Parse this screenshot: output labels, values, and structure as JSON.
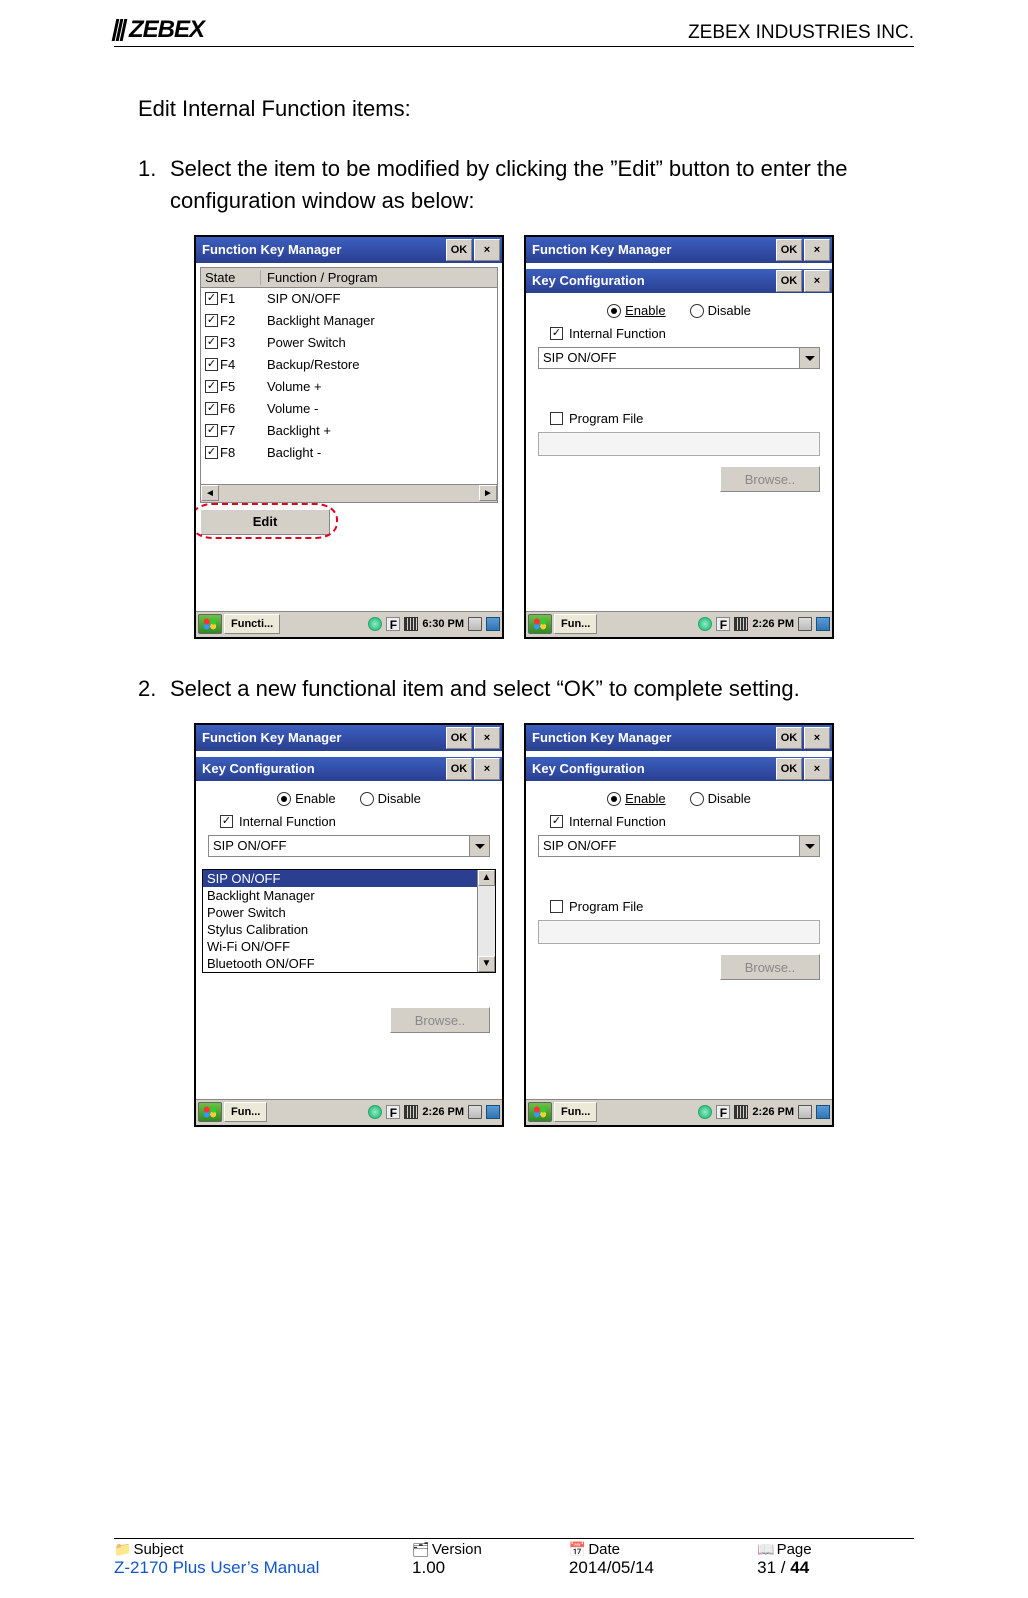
{
  "header": {
    "logo_text": "ZEBEX",
    "company": "ZEBEX INDUSTRIES INC."
  },
  "text": {
    "intro": "Edit Internal Function items:",
    "step1_num": "1.",
    "step1": "Select the item to be modified by clicking the ”Edit” button to enter the configuration window as below:",
    "step2_num": "2.",
    "step2": "Select a new functional item and select “OK” to complete setting."
  },
  "winCE": {
    "mainTitle": "Function Key Manager",
    "ok": "OK",
    "close": "×",
    "edit": "Edit",
    "headers": {
      "state": "State",
      "func": "Function / Program"
    },
    "rows": [
      {
        "key": "F1",
        "fn": "SIP ON/OFF"
      },
      {
        "key": "F2",
        "fn": "Backlight Manager"
      },
      {
        "key": "F3",
        "fn": "Power Switch"
      },
      {
        "key": "F4",
        "fn": "Backup/Restore"
      },
      {
        "key": "F5",
        "fn": "Volume +"
      },
      {
        "key": "F6",
        "fn": "Volume -"
      },
      {
        "key": "F7",
        "fn": "Backlight +"
      },
      {
        "key": "F8",
        "fn": "Baclight -"
      }
    ],
    "task_long": "Functi...",
    "task_short": "Fun...",
    "time_a": "6:30 PM",
    "time_b": "2:26 PM"
  },
  "keyConfig": {
    "title": "Key Configuration",
    "enable": "Enable",
    "disable": "Disable",
    "internalFn": "Internal Function",
    "programFile": "Program File",
    "browse": "Browse..",
    "selected": "SIP ON/OFF",
    "options": [
      "SIP ON/OFF",
      "Backlight Manager",
      "Power Switch",
      "Stylus Calibration",
      "Wi-Fi ON/OFF",
      "Bluetooth ON/OFF"
    ]
  },
  "footer": {
    "labels": {
      "subject": "Subject",
      "version": "Version",
      "date": "Date",
      "page": "Page"
    },
    "subject": "Z-2170 Plus User’s Manual",
    "version": "1.00",
    "date": "2014/05/14",
    "page_cur": "31",
    "page_sep": " / ",
    "page_total": "44"
  }
}
